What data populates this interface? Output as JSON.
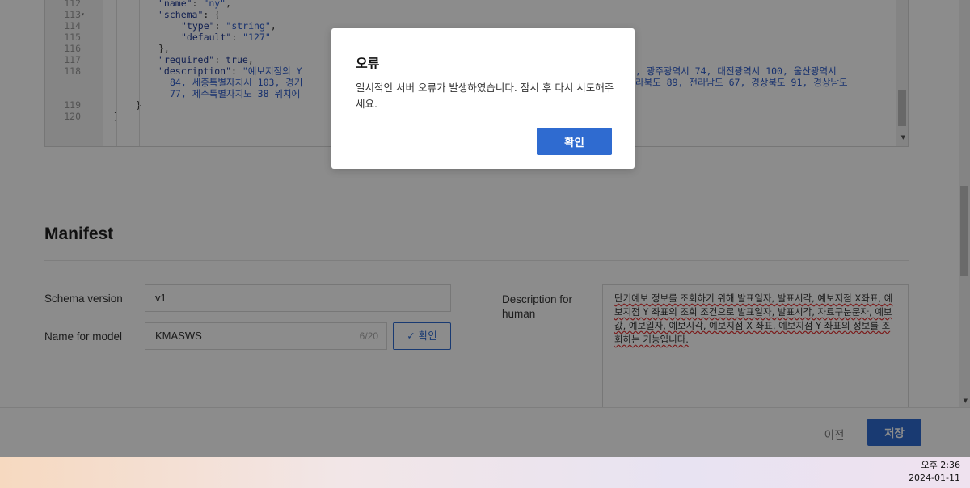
{
  "editor": {
    "lines": [
      {
        "num": "112",
        "fold": "",
        "parts": [
          [
            "k",
            "\"name\""
          ],
          [
            "p",
            ": "
          ],
          [
            "s",
            "\"ny\""
          ],
          [
            "p",
            ","
          ]
        ],
        "indent": 2
      },
      {
        "num": "113",
        "fold": "▾",
        "parts": [
          [
            "k",
            "\"schema\""
          ],
          [
            "p",
            ": {"
          ]
        ],
        "indent": 2
      },
      {
        "num": "114",
        "fold": "",
        "parts": [
          [
            "k",
            "\"type\""
          ],
          [
            "p",
            ": "
          ],
          [
            "s",
            "\"string\""
          ],
          [
            "p",
            ","
          ]
        ],
        "indent": 3
      },
      {
        "num": "115",
        "fold": "",
        "parts": [
          [
            "k",
            "\"default\""
          ],
          [
            "p",
            ": "
          ],
          [
            "s",
            "\"127\""
          ]
        ],
        "indent": 3
      },
      {
        "num": "116",
        "fold": "",
        "parts": [
          [
            "p",
            "},"
          ]
        ],
        "indent": 2
      },
      {
        "num": "117",
        "fold": "",
        "parts": [
          [
            "k",
            "\"required\""
          ],
          [
            "p",
            ": "
          ],
          [
            "v",
            "true"
          ],
          [
            "p",
            ","
          ]
        ],
        "indent": 2
      },
      {
        "num": "118",
        "fold": "",
        "parts": [
          [
            "k",
            "\"description\""
          ],
          [
            "p",
            ": "
          ],
          [
            "s",
            "\"예보지점의 Y"
          ]
        ],
        "indent": 2,
        "tail": ", 광주광역시 74, 대전광역시 100, 울산광역시"
      },
      {
        "num": "",
        "fold": "",
        "parts": [
          [
            "s",
            "84, 세종특별자치시 103, 경기"
          ]
        ],
        "indent": 2.5,
        "tail": "라북도 89, 전라남도 67, 경상북도 91, 경상남도"
      },
      {
        "num": "",
        "fold": "",
        "parts": [
          [
            "s",
            "77, 제주특별자치도 38 위치에"
          ]
        ],
        "indent": 2.5,
        "tail": ""
      },
      {
        "num": "119",
        "fold": "",
        "parts": [
          [
            "p",
            "}"
          ]
        ],
        "indent": 1
      },
      {
        "num": "120",
        "fold": "",
        "parts": [
          [
            "p",
            "]"
          ]
        ],
        "indent": 0
      }
    ]
  },
  "manifest": {
    "title": "Manifest",
    "schema_version_label": "Schema version",
    "schema_version_value": "v1",
    "name_for_model_label": "Name for model",
    "name_for_model_value": "KMASWS",
    "name_for_model_count": "6/20",
    "confirm_label": "✓ 확인",
    "description_label": "Description for human",
    "description_value": "단기예보 정보를 조회하기 위해 발표일자, 발표시각, 예보지점 X좌표, 예보지점 Y 좌표의 조회 조건으로 발표일자, 발표시각, 자료구분문자, 예보 값, 예보일자, 예보시각, 예보지점 X 좌표, 예보지점 Y 좌표의 정보를 조회하는 기능입니다."
  },
  "footer": {
    "prev_label": "이전",
    "save_label": "저장"
  },
  "modal": {
    "title": "오류",
    "message": "일시적인 서버 오류가 발생하였습니다. 잠시 후 다시 시도해주세요.",
    "ok_label": "확인"
  },
  "taskbar": {
    "time": "오후 2:36",
    "date": "2024-01-11"
  },
  "colors": {
    "accent": "#2f6bd0",
    "overlay": "rgba(0,0,0,0.45)"
  }
}
